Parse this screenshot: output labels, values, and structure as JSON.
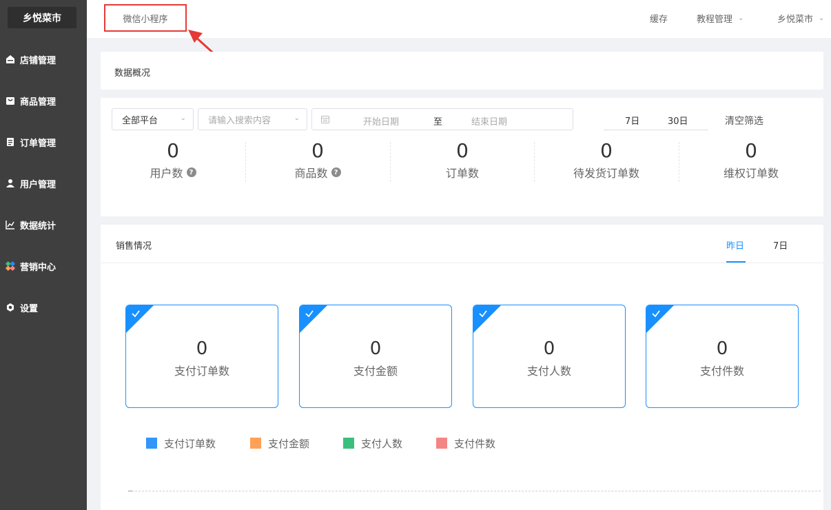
{
  "sidebar": {
    "brand": "乡悦菜市",
    "items": [
      {
        "label": "店铺管理",
        "icon": "store-icon"
      },
      {
        "label": "商品管理",
        "icon": "goods-icon"
      },
      {
        "label": "订单管理",
        "icon": "order-icon"
      },
      {
        "label": "用户管理",
        "icon": "user-icon"
      },
      {
        "label": "数据统计",
        "icon": "chart-icon"
      },
      {
        "label": "营销中心",
        "icon": "marketing-icon"
      },
      {
        "label": "设置",
        "icon": "settings-icon"
      }
    ]
  },
  "topbar": {
    "mini_program_tab": "微信小程序",
    "cache": "缓存",
    "tutorial": "教程管理",
    "store_name": "乡悦菜市"
  },
  "overview": {
    "title": "数据概况"
  },
  "filters": {
    "platform": "全部平台",
    "search_placeholder": "请输入搜索内容",
    "start_date": "开始日期",
    "separator": "至",
    "end_date": "结束日期",
    "range_7": "7日",
    "range_30": "30日",
    "clear": "清空筛选"
  },
  "stats": [
    {
      "value": "0",
      "label": "用户数",
      "help": true
    },
    {
      "value": "0",
      "label": "商品数",
      "help": true
    },
    {
      "value": "0",
      "label": "订单数",
      "help": false
    },
    {
      "value": "0",
      "label": "待发货订单数",
      "help": false
    },
    {
      "value": "0",
      "label": "维权订单数",
      "help": false
    }
  ],
  "sales": {
    "title": "销售情况",
    "tabs": [
      {
        "label": "昨日",
        "active": true
      },
      {
        "label": "7日",
        "active": false
      }
    ],
    "cards": [
      {
        "value": "0",
        "label": "支付订单数"
      },
      {
        "value": "0",
        "label": "支付金额"
      },
      {
        "value": "0",
        "label": "支付人数"
      },
      {
        "value": "0",
        "label": "支付件数"
      }
    ],
    "legend": [
      {
        "label": "支付订单数",
        "color": "#3296fa"
      },
      {
        "label": "支付金额",
        "color": "#ffa057"
      },
      {
        "label": "支付人数",
        "color": "#3cbf7e"
      },
      {
        "label": "支付件数",
        "color": "#f48585"
      }
    ]
  },
  "colors": {
    "accent": "#1890ff",
    "sidebar_bg": "#3f3f3f",
    "highlight": "#e53935"
  }
}
